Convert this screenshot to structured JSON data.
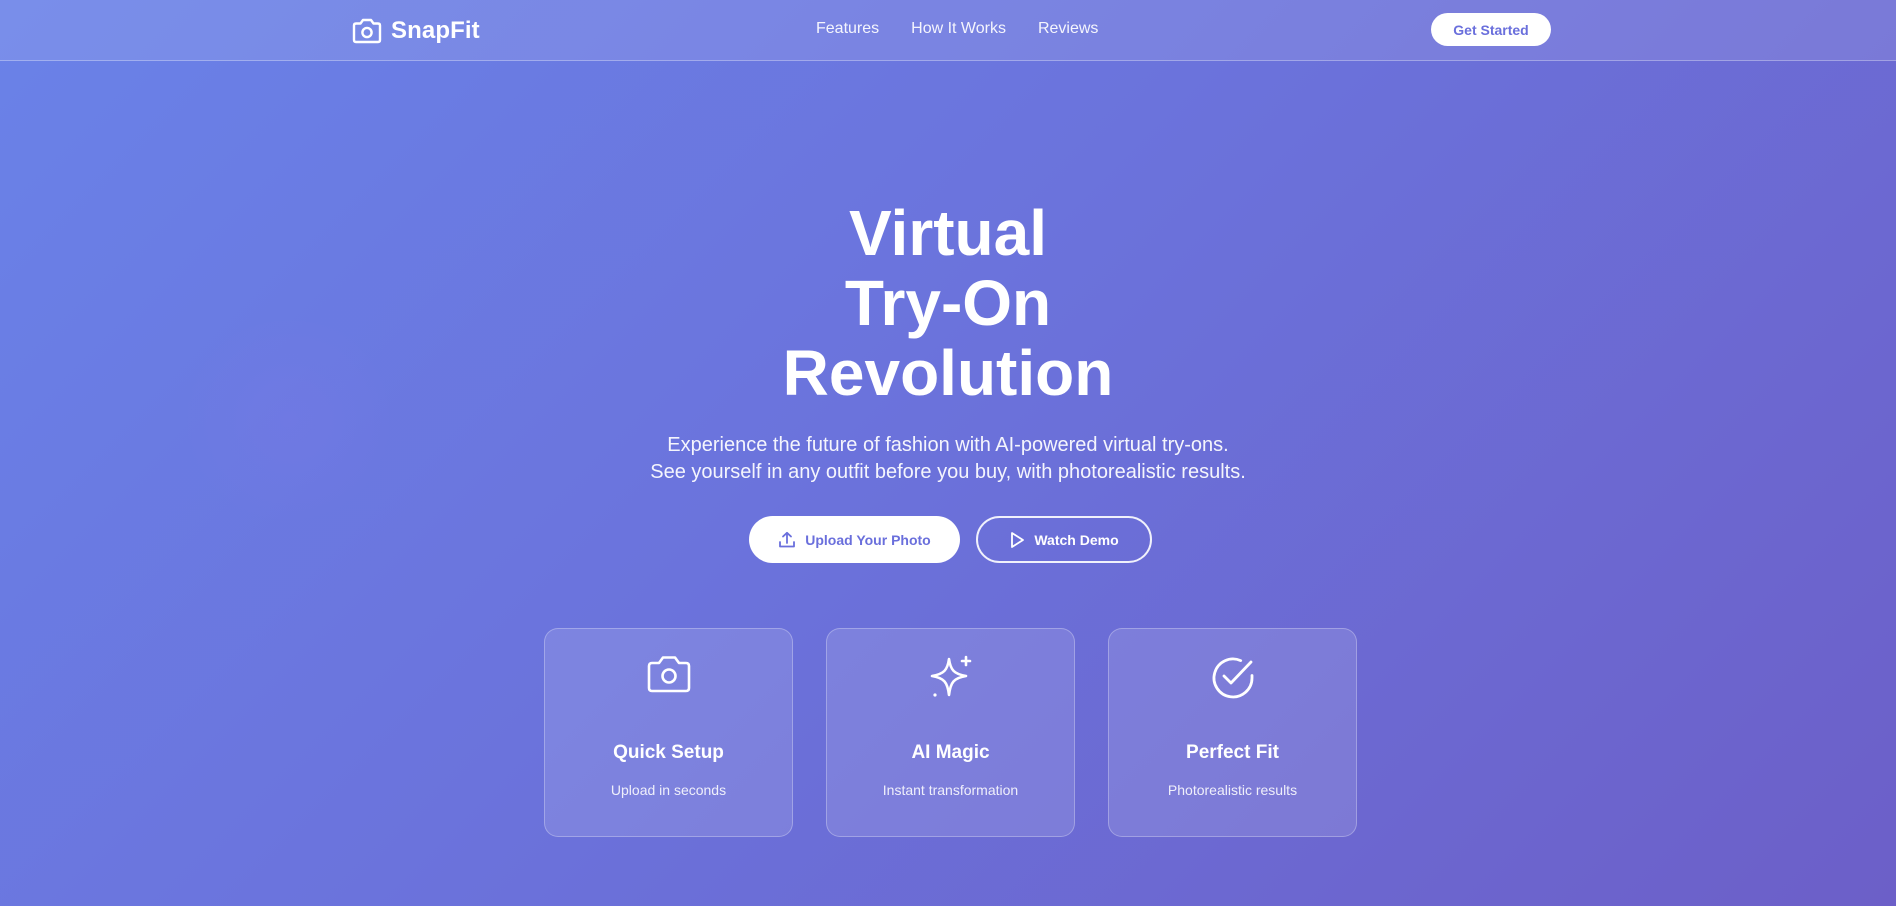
{
  "brand": {
    "name": "SnapFit",
    "icon": "camera-icon"
  },
  "nav": {
    "links": [
      "Features",
      "How It Works",
      "Reviews"
    ],
    "cta_label": "Get Started"
  },
  "hero": {
    "title_lines": [
      "Virtual",
      "Try-On",
      "Revolution"
    ],
    "subtitle_lines": [
      "Experience the future of fashion with AI-powered virtual try-ons.",
      "See yourself in any outfit before you buy, with photorealistic results."
    ],
    "primary_button": {
      "label": "Upload Your Photo",
      "icon": "upload-icon"
    },
    "secondary_button": {
      "label": "Watch Demo",
      "icon": "play-icon"
    }
  },
  "features": [
    {
      "icon": "camera-icon",
      "title": "Quick Setup",
      "description": "Upload in seconds"
    },
    {
      "icon": "sparkles-icon",
      "title": "AI Magic",
      "description": "Instant transformation"
    },
    {
      "icon": "check-circle-icon",
      "title": "Perfect Fit",
      "description": "Photorealistic results"
    }
  ],
  "colors": {
    "gradient_start": "#6a82e8",
    "gradient_end": "#6c5fc8",
    "accent": "#6a6fdc",
    "text": "#ffffff"
  }
}
